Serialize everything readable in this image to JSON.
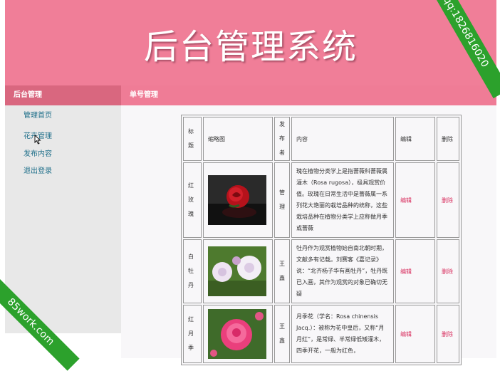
{
  "header": {
    "title": "后台管理系统"
  },
  "nav": {
    "left_label": "后台管理",
    "right_label": "单号管理"
  },
  "sidebar": {
    "items": [
      {
        "label": "管理首页"
      },
      {
        "label": "花卉管理"
      },
      {
        "label": "发布内容"
      },
      {
        "label": "退出登录"
      }
    ]
  },
  "table": {
    "headers": {
      "title": "标题",
      "thumb": "缩略图",
      "author": "发布者",
      "content": "内容",
      "edit": "编辑",
      "delete": "删除"
    },
    "rows": [
      {
        "title": "红玫瑰",
        "author": "管理",
        "content": "瑰在植物分类学上是指蔷薇科蔷薇属灌木（Rosa rugosa），极具观赏价值。玫瑰在日常生活中是蔷薇属一系列花大艳丽的栽培品种的统称，这些栽培品种在植物分类学上应称做月季或蔷薇",
        "edit": "编辑",
        "delete": "删除"
      },
      {
        "title": "白牡丹",
        "author": "王鑫",
        "content": "牡丹作为观赏植物始自南北朝时期，文献多有记载。刘赛客《嘉记录》说：“北齐杨子华有画牡丹”，牡丹既已入画，其作为观赏的对象已确切无疑",
        "edit": "编辑",
        "delete": "删除"
      },
      {
        "title": "红月季",
        "author": "王鑫",
        "content": "月季花（学名：Rosa chinensis Jacq.）：被称为花中皇后，又称“月月红”，是常绿、半常绿低矮灌木，四季开花，一般为红色，",
        "edit": "编辑",
        "delete": "删除"
      }
    ]
  },
  "watermarks": {
    "top_right": "qq:1826816020",
    "bottom_left": "85work.com"
  },
  "colors": {
    "header": "#f07e98",
    "nav_left": "#d9677f",
    "sidebar": "#e8e8e8",
    "ribbon": "#2ca12c",
    "action": "#d93060"
  }
}
